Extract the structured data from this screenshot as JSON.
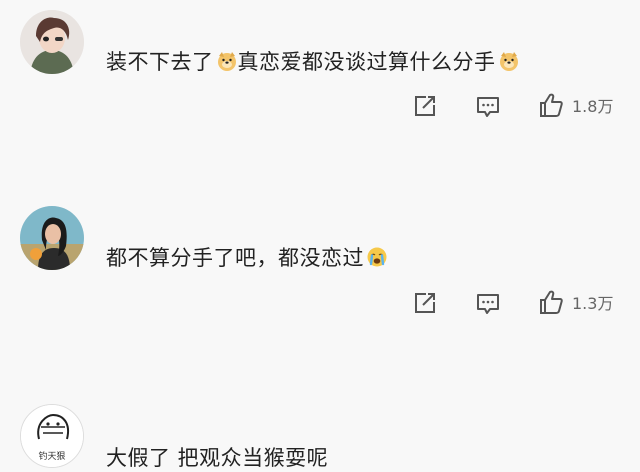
{
  "comments": [
    {
      "text": "装不下去了",
      "text_mid": "真恋爱都没谈过算什么分手",
      "emoji": "doge-emoji",
      "likes": "1.8万",
      "avatar": "anime-male-avatar"
    },
    {
      "text": "都不算分手了吧，都没恋过",
      "emoji": "crying-face-emoji",
      "likes": "1.3万",
      "avatar": "woman-photo-avatar"
    },
    {
      "text": "大假了 把观众当猴耍呢",
      "avatar_label": "钓天狠",
      "avatar": "doodle-avatar"
    }
  ],
  "icons": {
    "share": "share-icon",
    "reply": "comment-icon",
    "like": "thumbs-up-icon"
  }
}
